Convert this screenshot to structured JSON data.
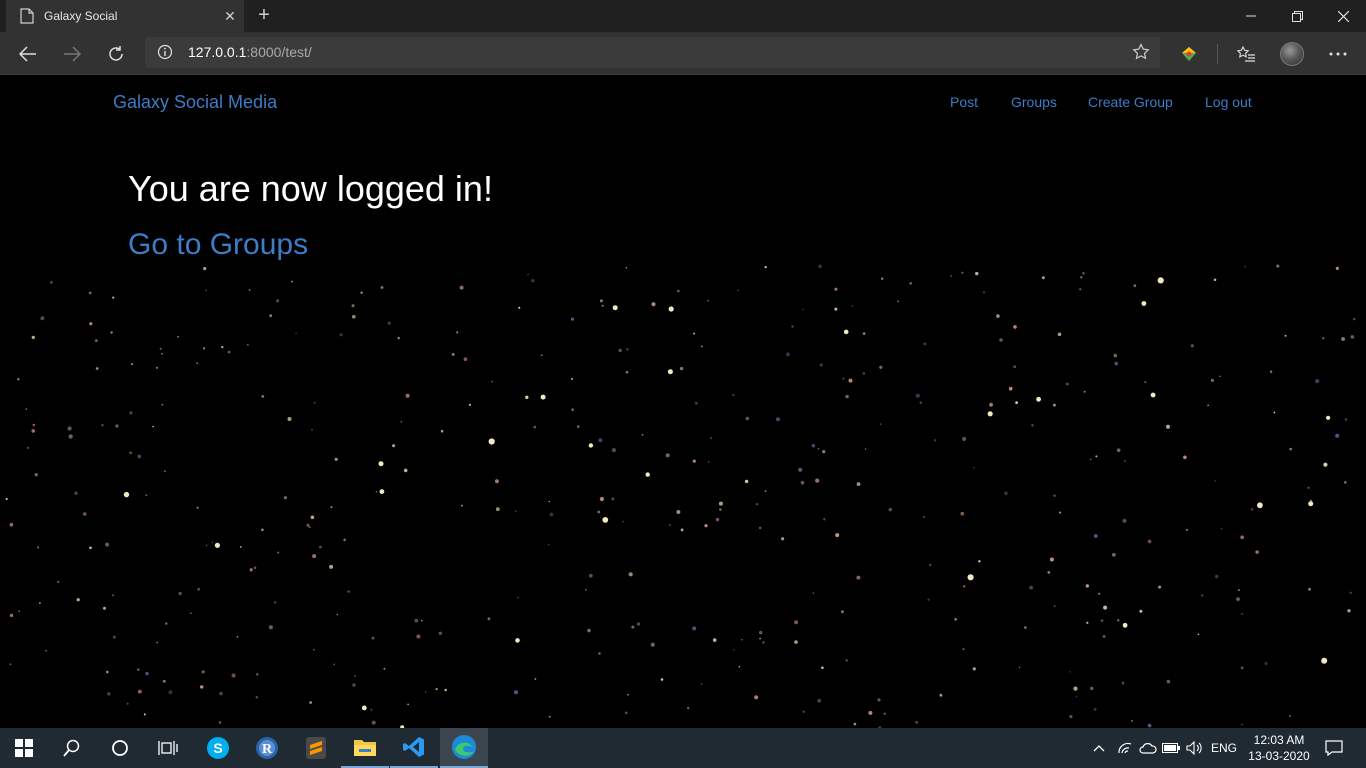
{
  "browser": {
    "tab_title": "Galaxy Social",
    "url_host": "127.0.0.1",
    "url_rest": ":8000/test/"
  },
  "navbar": {
    "brand": "Galaxy Social Media",
    "links": [
      "Post",
      "Groups",
      "Create Group",
      "Log out"
    ]
  },
  "main": {
    "heading": "You are now logged in!",
    "link": "Go to Groups"
  },
  "taskbar": {
    "language": "ENG",
    "time": "12:03 AM",
    "date": "13-03-2020"
  },
  "colors": {
    "link": "#3d7cc7",
    "background": "#000000"
  }
}
